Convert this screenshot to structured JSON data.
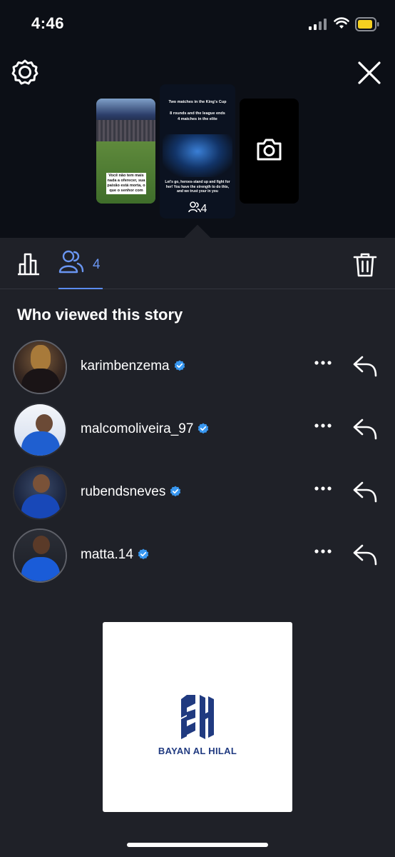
{
  "status_bar": {
    "time": "4:46",
    "battery_color": "#f5d020"
  },
  "story_thumbs": {
    "left_caption": "Você não tem mais nada a oferecer, sua paixão está morta, o que o senhor com",
    "center_lines": [
      "Two matches in the King's Cup",
      "8 rounds and the league ends",
      "4 matches in the elite",
      "Let's go, heroes-stand up and fight for her! You have the strength to do this, and we trust your in you"
    ],
    "center_viewer_count": "4",
    "right_icon": "camera-icon"
  },
  "tabs": {
    "viewers_count": "4",
    "active_color": "#5b8cf0"
  },
  "viewers_section": {
    "title": "Who viewed this story",
    "viewers": [
      {
        "username": "karimbenzema",
        "verified": true
      },
      {
        "username": "malcomoliveira_97",
        "verified": true
      },
      {
        "username": "rubendsneves",
        "verified": true
      },
      {
        "username": "matta.14",
        "verified": true
      }
    ]
  },
  "ad": {
    "brand": "BAYAN AL HILAL",
    "logo_color": "#203a80"
  },
  "icons": {
    "settings": "settings-gear-icon",
    "close": "close-icon",
    "insights": "bar-chart-icon",
    "viewers": "people-icon",
    "delete": "trash-icon",
    "more": "more-horizontal-icon",
    "reply": "reply-arrow-icon",
    "verified": "verified-badge-icon"
  },
  "colors": {
    "background": "#1f2128",
    "top_background": "#0c0f16",
    "verified_blue": "#3897f0"
  }
}
